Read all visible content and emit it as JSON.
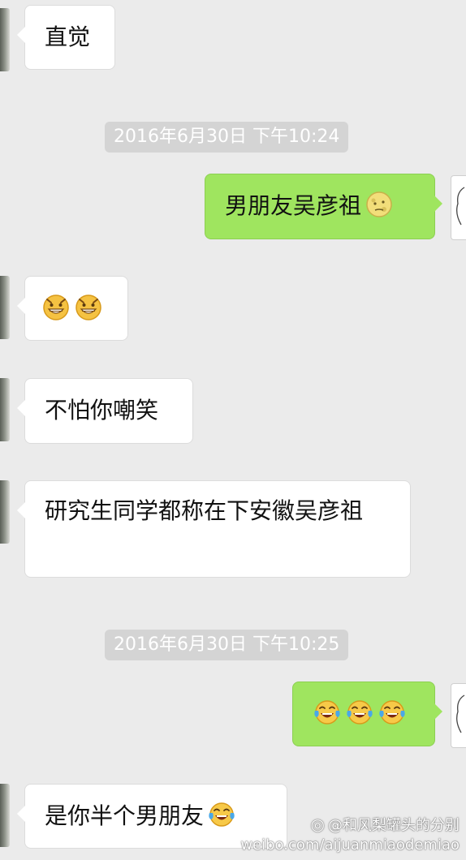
{
  "messages": [
    {
      "side": "in",
      "text": "直觉"
    },
    {
      "side": "out",
      "text": "男朋友吴彦祖",
      "emoji": [
        "moon-face"
      ]
    },
    {
      "side": "in",
      "text": "",
      "emoji": [
        "grin-face",
        "grin-face"
      ]
    },
    {
      "side": "in",
      "text": "不怕你嘲笑"
    },
    {
      "side": "in",
      "text": "研究生同学都称在下安徽吴彦祖"
    },
    {
      "side": "out",
      "text": "",
      "emoji": [
        "tears-of-joy",
        "tears-of-joy",
        "tears-of-joy"
      ]
    },
    {
      "side": "in",
      "text": "是你半个男朋友",
      "emoji": [
        "tears-of-joy"
      ]
    }
  ],
  "timestamps": [
    "2016年6月30日 下午10:24",
    "2016年6月30日 下午10:25"
  ],
  "watermark": {
    "handle": "@和风梨罐头的分别",
    "url": "weibo.com/aijuanmiaodemiao"
  },
  "colors": {
    "background": "#ebebeb",
    "incoming": "#ffffff",
    "outgoing": "#9fe55f",
    "timestamp": "#d4d4d4"
  }
}
